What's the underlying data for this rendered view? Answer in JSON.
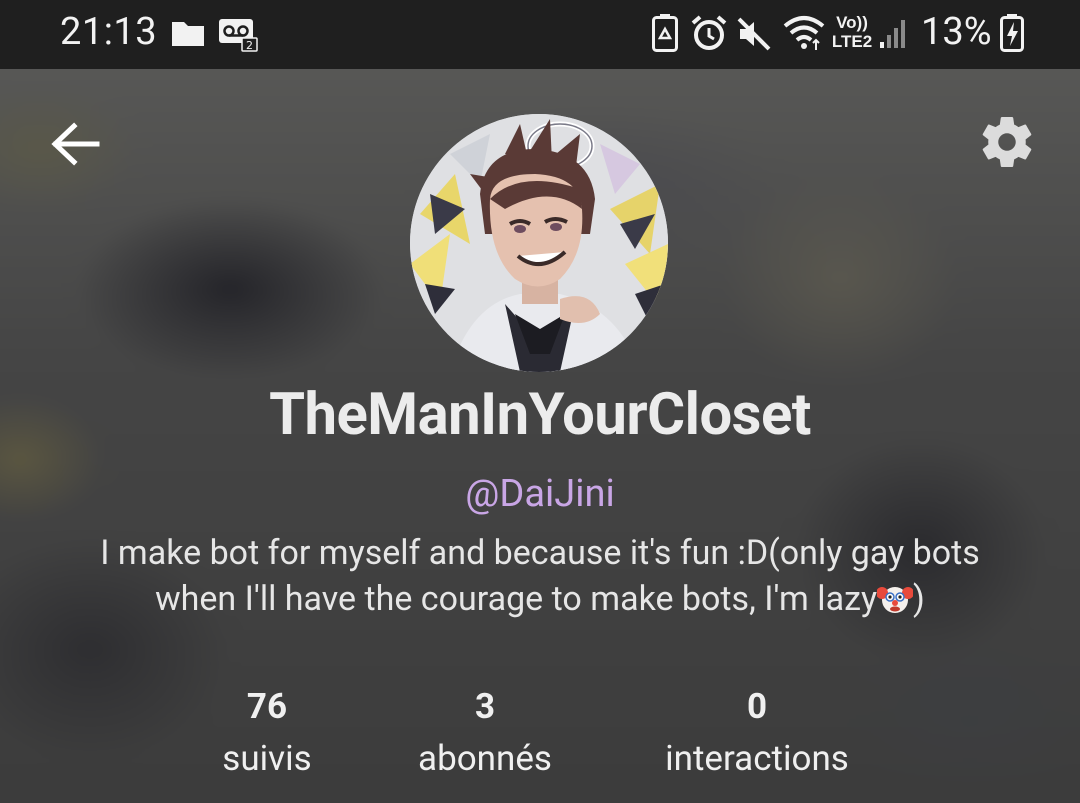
{
  "status_bar": {
    "time": "21:13",
    "battery_percent": "13%",
    "network": "LTE2",
    "volte": "Vo))",
    "icons": [
      "folder-icon",
      "voicemail-icon",
      "battery-saver-icon",
      "alarm-icon",
      "mute-icon",
      "wifi-icon",
      "signal-icon",
      "battery-charging-icon"
    ]
  },
  "header": {
    "back_icon": "arrow-left-icon",
    "settings_icon": "gear-icon"
  },
  "profile": {
    "display_name": "TheManInYourCloset",
    "handle": "@DaiJini",
    "bio": "I make bot for myself and because it's fun :D(only gay bots when I'll have the courage to make bots, I'm lazy",
    "bio_end": ")",
    "bio_emoji": "clown-face-icon"
  },
  "stats": {
    "following": {
      "value": "76",
      "label": "suivis"
    },
    "followers": {
      "value": "3",
      "label": "abonnés"
    },
    "interactions": {
      "value": "0",
      "label": "interactions"
    }
  },
  "colors": {
    "status_bar_bg": "#1f1f1f",
    "handle": "#c9a6e6",
    "text": "#ececec"
  }
}
